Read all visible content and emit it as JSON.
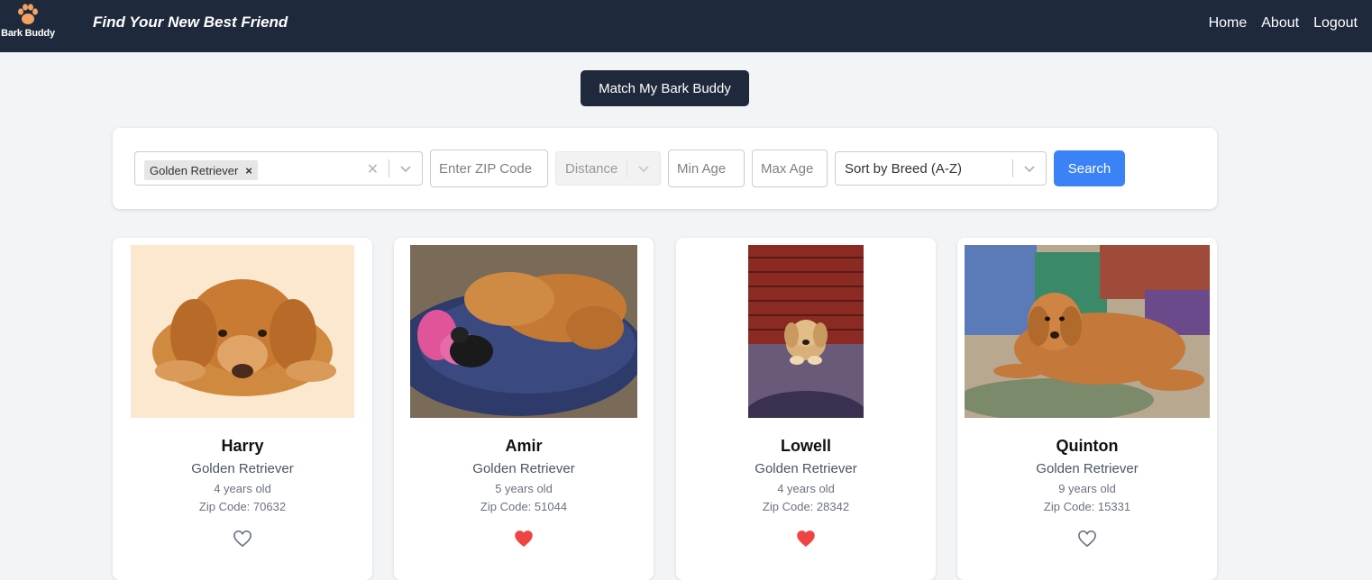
{
  "header": {
    "logo_text": "Bark Buddy",
    "tagline": "Find Your New Best Friend",
    "nav": [
      "Home",
      "About",
      "Logout"
    ]
  },
  "match_button": "Match My Bark Buddy",
  "filters": {
    "breed_selected": [
      "Golden Retriever"
    ],
    "zip_placeholder": "Enter ZIP Code",
    "distance_placeholder": "Distance",
    "min_age_placeholder": "Min Age",
    "max_age_placeholder": "Max Age",
    "sort_value": "Sort by Breed (A-Z)",
    "search_label": "Search"
  },
  "dogs": [
    {
      "name": "Harry",
      "breed": "Golden Retriever",
      "age": "4 years old",
      "zip_label": "Zip Code:",
      "zip": "70632",
      "favorited": false
    },
    {
      "name": "Amir",
      "breed": "Golden Retriever",
      "age": "5 years old",
      "zip_label": "Zip Code:",
      "zip": "51044",
      "favorited": true
    },
    {
      "name": "Lowell",
      "breed": "Golden Retriever",
      "age": "4 years old",
      "zip_label": "Zip Code:",
      "zip": "28342",
      "favorited": true
    },
    {
      "name": "Quinton",
      "breed": "Golden Retriever",
      "age": "9 years old",
      "zip_label": "Zip Code:",
      "zip": "15331",
      "favorited": false
    }
  ],
  "colors": {
    "navbar": "#1e293b",
    "page_bg": "#f3f4f6",
    "search_button": "#3b82f6",
    "heart_filled": "#ef4444",
    "heart_outline": "#6b7280"
  }
}
